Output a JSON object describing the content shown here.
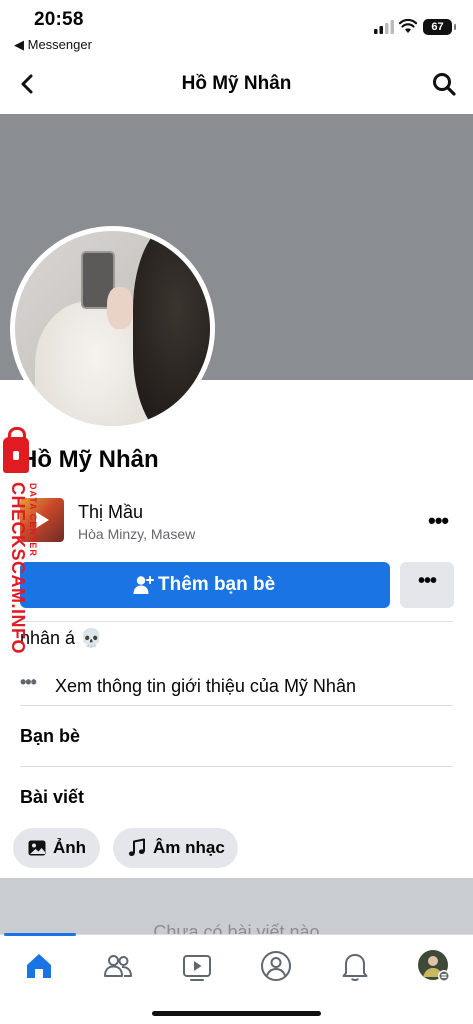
{
  "status_bar": {
    "time": "20:58",
    "back_app": "◀ Messenger",
    "battery": "67"
  },
  "nav": {
    "title": "Hồ Mỹ Nhân",
    "back_icon": "chevron-left-icon",
    "search_icon": "search-icon"
  },
  "profile": {
    "name": "Hồ Mỹ Nhân",
    "bio": "nhân á 💀"
  },
  "music": {
    "title": "Thị Mầu",
    "artist": "Hòa Minzy, Masew",
    "more_label": "•••"
  },
  "actions": {
    "add_friend_label": "Thêm bạn bè",
    "more_label": "•••"
  },
  "intro": {
    "dots": "•••",
    "label": "Xem thông tin giới thiệu của Mỹ Nhân"
  },
  "sections": {
    "friends": "Bạn bè",
    "posts": "Bài viết"
  },
  "filters": [
    {
      "label": "Ảnh",
      "icon": "photos-icon"
    },
    {
      "label": "Âm nhạc",
      "icon": "music-note-icon"
    }
  ],
  "posts_empty": "Chưa có bài viết nào",
  "watermark": {
    "text": "CHECKSCAM.INFO",
    "small": "DATA CENTER"
  },
  "tabs": [
    {
      "name": "home",
      "icon": "home-icon",
      "active": true
    },
    {
      "name": "friends",
      "icon": "friends-icon"
    },
    {
      "name": "watch",
      "icon": "video-icon"
    },
    {
      "name": "profile",
      "icon": "profile-icon"
    },
    {
      "name": "notifications",
      "icon": "bell-icon"
    },
    {
      "name": "menu",
      "icon": "avatar-menu-icon"
    }
  ],
  "colors": {
    "primary": "#1b74e4",
    "cover": "#8a8d91",
    "chip": "#e4e6eb",
    "watermark": "#e11b22"
  }
}
